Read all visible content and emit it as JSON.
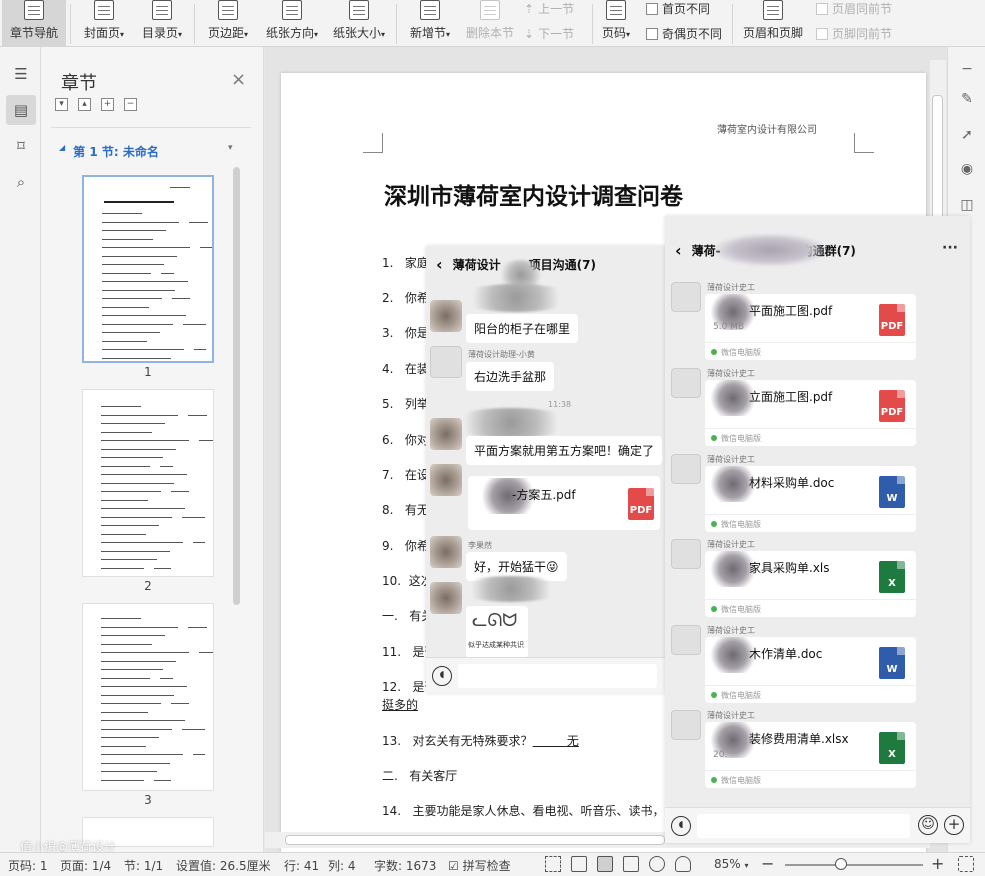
{
  "toolbar": {
    "nav_label": "章节导航",
    "cover_label": "封面页",
    "toc_label": "目录页",
    "margin_label": "页边距",
    "orient_label": "纸张方向",
    "size_label": "纸张大小",
    "new_section_label": "新增节",
    "delete_section_label": "删除本节",
    "prev_section_label": "上一节",
    "next_section_label": "下一节",
    "page_num_label": "页码",
    "first_diff_label": "首页不同",
    "odd_even_label": "奇偶页不同",
    "header_footer_label": "页眉和页脚",
    "header_same_label": "页眉同前节",
    "footer_same_label": "页脚同前节",
    "dropdown_glyph": "▾"
  },
  "nav_pane": {
    "title": "章节",
    "close_glyph": "×",
    "tool_glyphs": [
      "▾",
      "▴",
      "+",
      "−"
    ],
    "section_caret": "◢",
    "section_label": "第 1 节: 未命名",
    "section_menu": "▾",
    "page_numbers": [
      "1",
      "2",
      "3"
    ]
  },
  "document": {
    "header_text": "薄荷室内设计有限公司",
    "title": "深圳市薄荷室内设计调查问卷",
    "items": [
      {
        "label": "1.",
        "text": "家庭"
      },
      {
        "label": "2.",
        "text": "你希"
      },
      {
        "label": "3.",
        "text": "你是"
      },
      {
        "label": "4.",
        "text": "在装"
      },
      {
        "label": "5.",
        "text": "列举"
      },
      {
        "label": "6.",
        "text": "你对"
      },
      {
        "label": "7.",
        "text": "在设"
      },
      {
        "label": "8.",
        "text": "有无"
      },
      {
        "label": "9.",
        "text": "你希"
      },
      {
        "label": "10.",
        "text": "这次"
      },
      {
        "label": "一.",
        "text": "有关"
      },
      {
        "label": "11.",
        "text": "是否"
      },
      {
        "label": "12.",
        "text": "是否"
      }
    ],
    "continuation": "挺多的",
    "q13_label": "13.",
    "q13_text": "对玄关有无特殊要求？",
    "q13_answer": "无",
    "sec2_label": "二.",
    "sec2_text": "有关客厅",
    "q14_label": "14.",
    "q14_text": "主要功能是家人休息、看电视、听音乐、读书，还"
  },
  "chat1": {
    "back": "‹",
    "title_pre": "薄荷设计",
    "title_post": "项目沟通(7)",
    "messages": {
      "m1": "阳台的柜子在哪里",
      "sender2": "薄荷设计助理-小黄",
      "m2": "右边洗手盆那",
      "time": "11:38",
      "m3": "平面方案就用第五方案吧！确定了",
      "file_name": "-方案五.pdf",
      "file_type": "PDF",
      "sender4": "李果然",
      "m4": "好，开始猛干😜",
      "sticker_caption": "似乎达成某种共识"
    },
    "voice_glyph": "◖"
  },
  "chat2": {
    "back": "‹",
    "title_pre": "薄荷-",
    "title_post": "沟通群(7)",
    "more": "···",
    "sender": "薄荷设计史工",
    "files": [
      {
        "name": "平面施工图.pdf",
        "size": "5.0 MB",
        "type": "PDF",
        "color": "#e34b4b"
      },
      {
        "name": "立面施工图.pdf",
        "size": "",
        "type": "PDF",
        "color": "#e34b4b"
      },
      {
        "name": "材料采购单.doc",
        "size": "",
        "type": "W",
        "color": "#2f5dab"
      },
      {
        "name": "家具采购单.xls",
        "size": "",
        "type": "X",
        "color": "#1f7a3f"
      },
      {
        "name": "木作清单.doc",
        "size": "",
        "type": "W",
        "color": "#2f5dab"
      },
      {
        "name": "装修费用清单.xlsx",
        "size": "20.",
        "type": "X",
        "color": "#1f7a3f"
      }
    ],
    "file_source": "微信电脑版",
    "voice_glyph": "◖",
    "emoji_glyph": "☺",
    "plus_glyph": "+"
  },
  "statusbar": {
    "page_code": "页码: 1",
    "page_count": "页面: 1/4",
    "section": "节: 1/1",
    "setting": "设置值: 26.5厘米",
    "row": "行: 41",
    "col": "列: 4",
    "word_count": "字数: 1673",
    "spell_check": "拼写检查",
    "zoom": "85%",
    "zoom_minus": "−",
    "zoom_plus": "+"
  },
  "watermark": "值小编@薄荷设计"
}
